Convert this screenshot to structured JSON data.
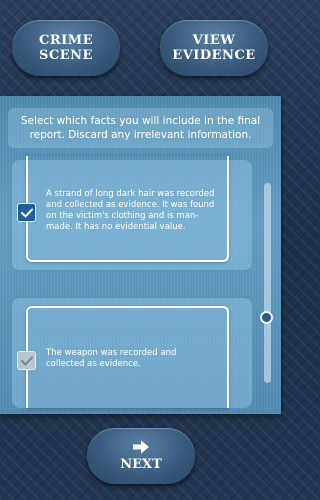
{
  "top_buttons": {
    "crime_scene": {
      "line1": "CRIME",
      "line2": "SCENE"
    },
    "view_evidence": {
      "line1": "VIEW",
      "line2": "EVIDENCE"
    }
  },
  "instructions": "Select which facts you will include in the final report. Discard any irrelevant information.",
  "facts": [
    {
      "text": "A strand of long dark hair was recorded and collected as evidence. It was found on the victim's clothing and is man-made. It has no evidential value.",
      "checked": true
    },
    {
      "text": "The weapon was recorded and collected as evidence.",
      "checked": true
    }
  ],
  "next_button": {
    "label": "NEXT",
    "icon": "arrow-right-icon"
  },
  "colors": {
    "accent": "#1f5f9e",
    "panel": "#5e9ac0",
    "background": "#233650"
  }
}
